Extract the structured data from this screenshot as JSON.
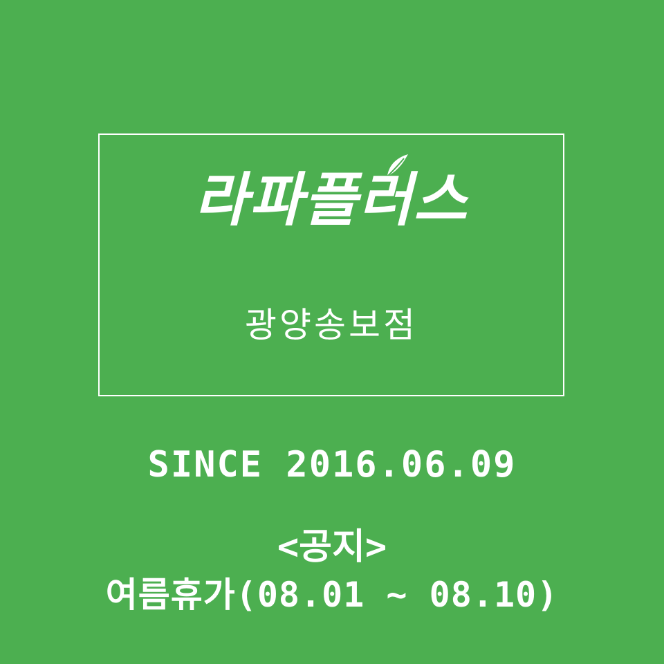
{
  "brand": {
    "name": "라파플러스",
    "branch": "광양송보점"
  },
  "since": "SINCE 2016.06.09",
  "notice": {
    "title": "<공지>",
    "body": "여름휴가(08.01 ~ 08.10)"
  },
  "colors": {
    "background": "#4caf50",
    "text": "#ffffff"
  },
  "icons": {
    "leaf": "leaf-icon"
  }
}
